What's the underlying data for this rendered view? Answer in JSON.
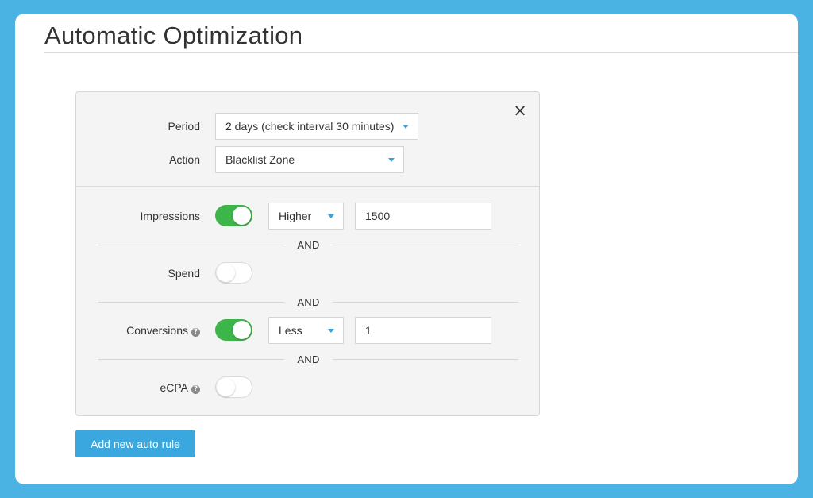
{
  "page": {
    "title": "Automatic Optimization"
  },
  "rule": {
    "close_symbol": "×",
    "period": {
      "label": "Period",
      "selected": "2 days (check interval 30 minutes)"
    },
    "action": {
      "label": "Action",
      "selected": "Blacklist Zone"
    },
    "conditions": [
      {
        "label": "Impressions",
        "enabled": true,
        "operator": "Higher",
        "value": "1500",
        "has_help": false
      },
      {
        "label": "Spend",
        "enabled": false,
        "has_help": false
      },
      {
        "label": "Conversions",
        "enabled": true,
        "operator": "Less",
        "value": "1",
        "has_help": true
      },
      {
        "label": "eCPA",
        "enabled": false,
        "has_help": true
      }
    ],
    "and_label": "AND",
    "help_symbol": "?"
  },
  "add_button_label": "Add new auto rule",
  "colors": {
    "background": "#4ab3e3",
    "accent": "#3aa8df",
    "toggle_on": "#3cb54a",
    "caret": "#3aa4d9"
  }
}
